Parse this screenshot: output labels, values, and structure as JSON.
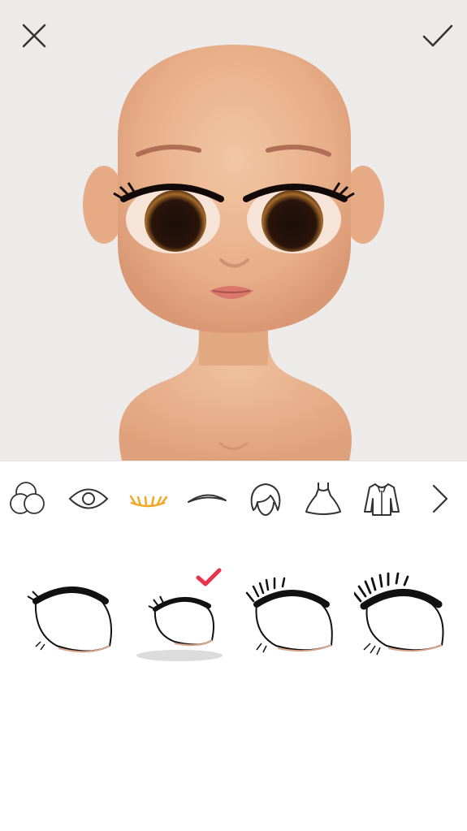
{
  "app": {
    "screen": "avatar-editor-eyelashes"
  },
  "topbar": {
    "close_icon": "close-icon",
    "confirm_icon": "checkmark-icon"
  },
  "toolbar": {
    "items": [
      {
        "icon": "skin-color-icon",
        "selected": false
      },
      {
        "icon": "eye-icon",
        "selected": false
      },
      {
        "icon": "eyelashes-icon",
        "selected": true
      },
      {
        "icon": "eyebrow-icon",
        "selected": false
      },
      {
        "icon": "hair-icon",
        "selected": false
      },
      {
        "icon": "dress-icon",
        "selected": false
      },
      {
        "icon": "jacket-icon",
        "selected": false
      },
      {
        "icon": "chevron-right-icon",
        "selected": false
      }
    ],
    "accent_color": "#f5a623"
  },
  "options": {
    "items": [
      {
        "name": "eyelash-style-1",
        "selected": false
      },
      {
        "name": "eyelash-style-2",
        "selected": true
      },
      {
        "name": "eyelash-style-3",
        "selected": false
      },
      {
        "name": "eyelash-style-4",
        "selected": false
      }
    ],
    "selected_mark_color": "#e8334a"
  }
}
